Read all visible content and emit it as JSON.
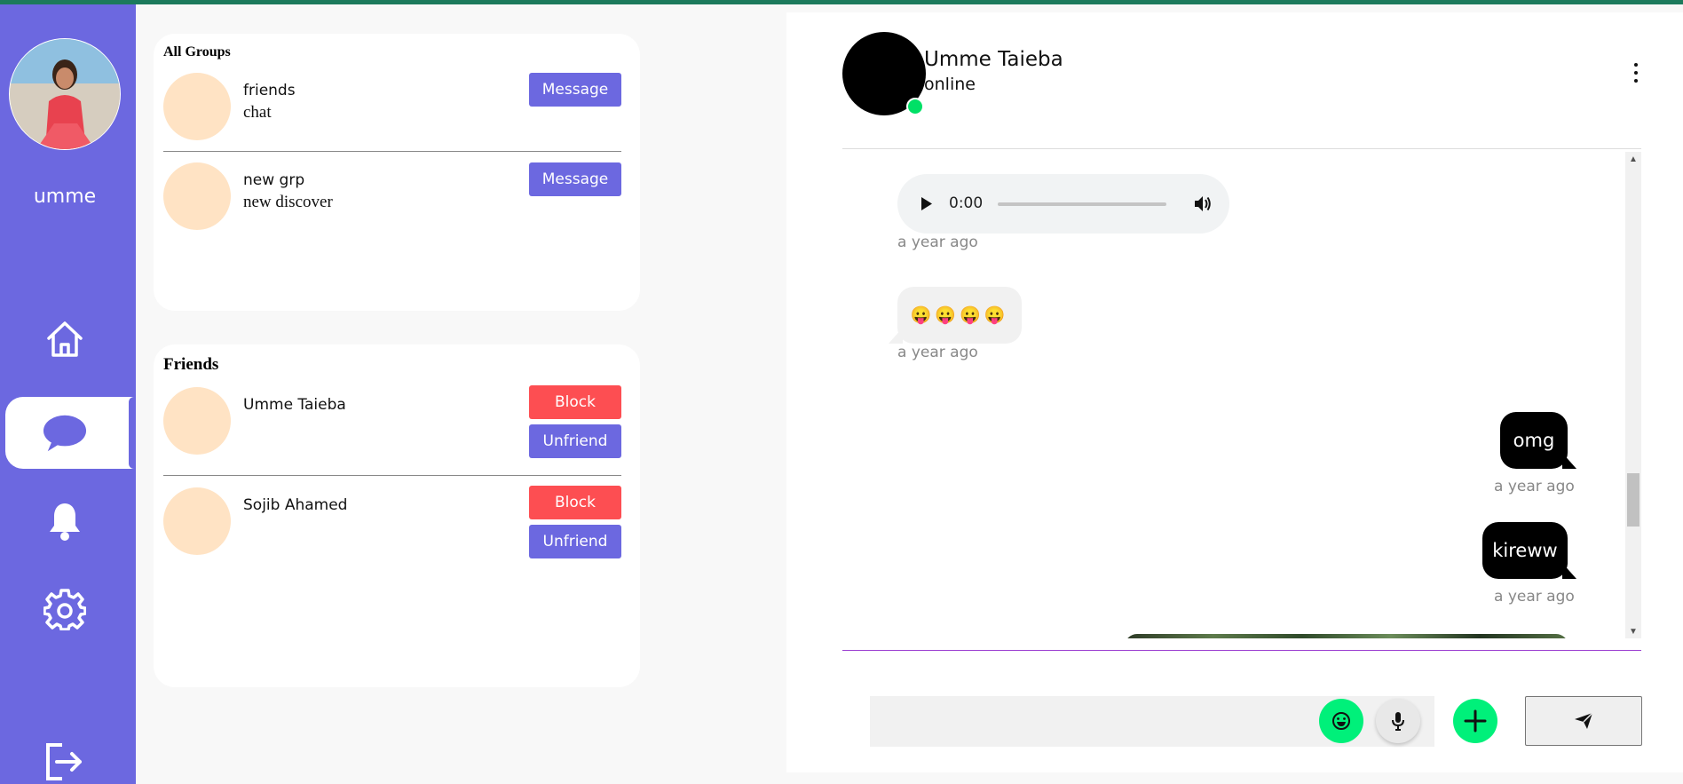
{
  "sidebar": {
    "user_name": "umme",
    "nav": [
      "home-icon",
      "chat-icon",
      "bell-icon",
      "gear-icon",
      "logout-icon"
    ],
    "accent": "#6c68e0"
  },
  "groups": {
    "title": "All Groups",
    "items": [
      {
        "name": "friends",
        "subtitle": "chat",
        "action": "Message"
      },
      {
        "name": "new grp",
        "subtitle": "new discover",
        "action": "Message"
      }
    ]
  },
  "friends": {
    "title": "Friends",
    "items": [
      {
        "name": "Umme Taieba",
        "block": "Block",
        "unfriend": "Unfriend"
      },
      {
        "name": "Sojib Ahamed",
        "block": "Block",
        "unfriend": "Unfriend"
      }
    ]
  },
  "chat": {
    "contact_name": "Umme Taieba",
    "status": "online",
    "audio_time": "0:00",
    "messages": [
      {
        "type": "audio",
        "time": "a year ago"
      },
      {
        "type": "emoji",
        "text": "😛😛😛😛",
        "time": "a year ago"
      },
      {
        "type": "text",
        "text": "omg",
        "time": "a year ago"
      },
      {
        "type": "text",
        "text": "kireww",
        "time": "a year ago"
      },
      {
        "type": "image"
      }
    ]
  },
  "composer": {
    "icons": [
      "emoji-icon",
      "mic-icon",
      "plus-icon",
      "send-icon"
    ]
  }
}
